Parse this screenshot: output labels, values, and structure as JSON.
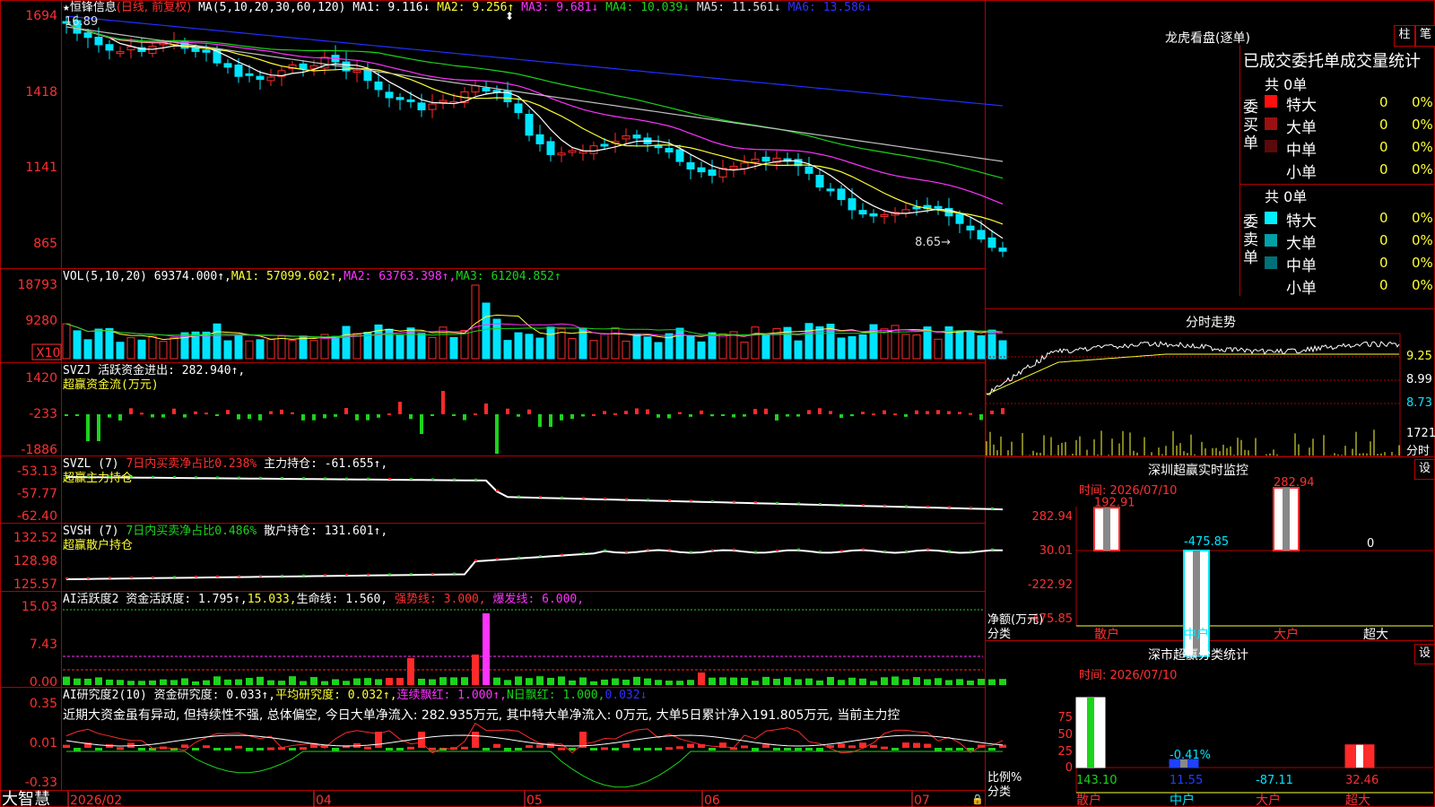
{
  "colors": {
    "up": "#ff2a2a",
    "down": "#00e5ff",
    "green": "#1bd41b",
    "yellow": "#ffff33",
    "magenta": "#ff33ff",
    "white": "#ffffff",
    "grid": "#b00000"
  },
  "main_header": {
    "star": "★",
    "name": "恒锋信息",
    "mode": "(日线, 前复权)",
    "ma_label": "MA(5,10,20,30,60,120)",
    "ma1": "MA1: 9.116↓",
    "ma2": "MA2: 9.256↑",
    "ma3": "MA3: 9.681↓",
    "ma4": "MA4: 10.039↓",
    "ma5": "MA5: 11.561↓",
    "ma6": "MA6: 13.586↓",
    "high_marker": "16.89",
    "low_marker": "8.65→"
  },
  "main_axis": [
    "1694",
    "1418",
    "1141",
    "865"
  ],
  "vol_header": {
    "label": "VOL(5,10,20)",
    "value": "69374.000↑,",
    "ma1": "MA1: 57099.602↑,",
    "ma2": "MA2: 63763.398↑,",
    "ma3": "MA3: 61204.852↑"
  },
  "vol_axis": [
    "18793",
    "9280"
  ],
  "vol_unit": "X10",
  "svzj_header": {
    "label": "SVZJ  活跃资金进出: 282.940↑,",
    "sub": "超赢资金流(万元)"
  },
  "svzj_axis": [
    "1420",
    "-233",
    "-1886"
  ],
  "svzl_header": {
    "label": "SVZL (7)",
    "ratio": "7日内买卖净占比0.238%",
    "hold": "主力持仓: -61.655↑,",
    "sub": "超赢主力持仓"
  },
  "svzl_axis": [
    "-53.13",
    "-57.77",
    "-62.40"
  ],
  "svsh_header": {
    "label": "SVSH (7)",
    "ratio": "7日内买卖净占比0.486%",
    "hold": "散户持仓: 131.601↑,",
    "sub": "超赢散户持仓"
  },
  "svsh_axis": [
    "132.52",
    "128.98",
    "125.57"
  ],
  "ai1_header": {
    "label": "AI活跃度2",
    "t1": "资金活跃度: 1.795↑,",
    "t2": "15.033,",
    "t3": "生命线: 1.560,",
    "t4": "强势线: 3.000,",
    "t5": "爆发线: 6.000,"
  },
  "ai1_axis": [
    "15.03",
    "7.43",
    "0.00"
  ],
  "ai2_header": {
    "label": "AI研究度2(10)",
    "t1": "资金研究度: 0.033↑,",
    "t2": "平均研究度: 0.032↑,",
    "t3": "连续飘红: 1.000↑,",
    "t4": "N日飘红: 1.000,",
    "t5": "0.032↓"
  },
  "ai2_axis": [
    "0.35",
    "0.01",
    "-0.33"
  ],
  "ai2_note": "近期大资金虽有异动, 但持续性不强, 总体偏空, 今日大单净流入: 282.935万元, 其中特大单净流入: 0万元, 大单5日累计净入191.805万元, 当前主力控",
  "bottom": {
    "brand": "大智慧",
    "dates": [
      "2026/02",
      "04",
      "05",
      "06",
      "07"
    ]
  },
  "right": {
    "longhu_title": "龙虎看盘(逐单)",
    "tab1": "柱",
    "tab2": "笔",
    "stat_title": "已成交委托单成交量统计",
    "buy": {
      "side": "委买单",
      "total": "共 0单",
      "rows": [
        {
          "label": "特大",
          "count": "0",
          "pct": "0%"
        },
        {
          "label": "大单",
          "count": "0",
          "pct": "0%"
        },
        {
          "label": "中单",
          "count": "0",
          "pct": "0%"
        },
        {
          "label": "小单",
          "count": "0",
          "pct": "0%"
        }
      ]
    },
    "sell": {
      "side": "委卖单",
      "total": "共 0单",
      "rows": [
        {
          "label": "特大",
          "count": "0",
          "pct": "0%"
        },
        {
          "label": "大单",
          "count": "0",
          "pct": "0%"
        },
        {
          "label": "中单",
          "count": "0",
          "pct": "0%"
        },
        {
          "label": "小单",
          "count": "0",
          "pct": "0%"
        }
      ]
    },
    "intraday": {
      "title": "分时走势",
      "axis": [
        "9.25",
        "8.99",
        "8.73"
      ],
      "vol": "1721",
      "vol_unit": "分时"
    },
    "monitor": {
      "title": "深圳超赢实时监控",
      "set": "设",
      "time": "时间: 2026/07/10",
      "axis": [
        "282.94",
        "30.01",
        "-222.92",
        "-475.85"
      ],
      "ylabel": "净额(万元)",
      "xlabel": "分类",
      "bars": [
        {
          "cat": "散户",
          "label": "192.91",
          "value": 192.91
        },
        {
          "cat": "中户",
          "label": "-475.85",
          "value": -475.85
        },
        {
          "cat": "大户",
          "label": "282.94",
          "value": 282.94
        },
        {
          "cat": "超大",
          "label": "0",
          "value": 0
        }
      ]
    },
    "classify": {
      "title": "深市超赢分类统计",
      "set": "设",
      "time": "时间: 2026/07/10",
      "axis": [
        "75",
        "50",
        "25",
        "0"
      ],
      "ylabel": "比例%",
      "xlabel": "分类",
      "bars": [
        {
          "cat": "散户",
          "label": "143.10",
          "value": 100
        },
        {
          "cat": "中户",
          "label": "11.55",
          "value": 11.55,
          "extra": "-0.41%"
        },
        {
          "cat": "大户",
          "label": "-87.11",
          "value": 0
        },
        {
          "cat": "超大",
          "label": "32.46",
          "value": 32.46
        }
      ]
    }
  }
}
